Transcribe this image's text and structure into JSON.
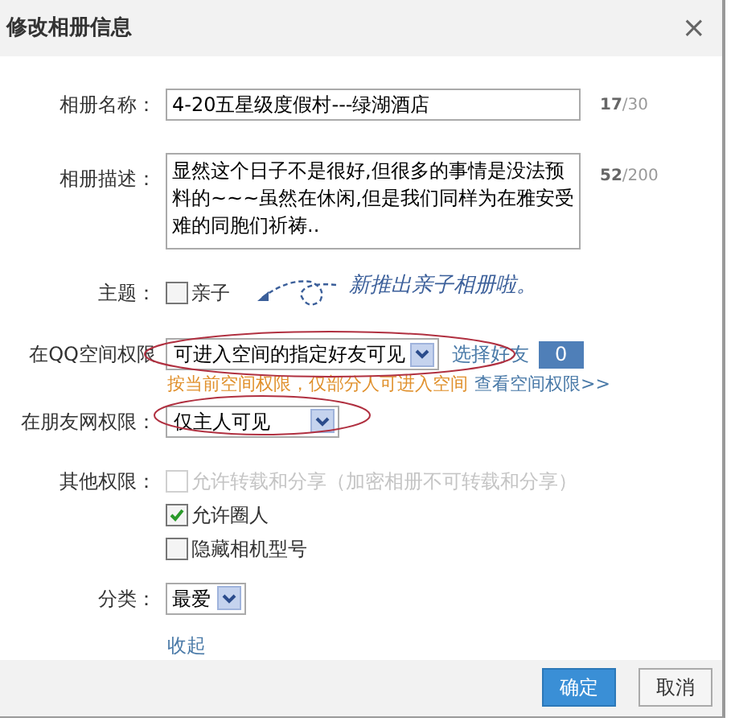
{
  "dialog": {
    "title": "修改相册信息",
    "close": "×"
  },
  "name_field": {
    "label": "相册名称：",
    "value": "4-20五星级度假村---绿湖酒店",
    "counter_used": "17",
    "counter_max": "/30"
  },
  "description_field": {
    "label": "相册描述：",
    "value": "显然这个日子不是很好,但很多的事情是没法预料的~~~虽然在休闲,但是我们同样为在雅安受难的同胞们祈祷..",
    "counter_used": "52",
    "counter_max": "/200"
  },
  "theme": {
    "label": "主题：",
    "option": {
      "label": "亲子",
      "checked": false
    },
    "annotation": "新推出亲子相册啦。"
  },
  "qq_permission": {
    "label": "在QQ空间权限",
    "value": "可进入空间的指定好友可见",
    "select_friends": "选择好友",
    "friend_count": "0",
    "hint": "按当前空间权限，仅部分人可进入空间",
    "link": "查看空间权限>>"
  },
  "friend_permission": {
    "label": "在朋友网权限：",
    "value": "仅主人可见"
  },
  "other_permissions": {
    "label": "其他权限：",
    "options": [
      {
        "label": "允许转载和分享（加密相册不可转载和分享）",
        "checked": false,
        "disabled": true
      },
      {
        "label": "允许圈人",
        "checked": true,
        "disabled": false
      },
      {
        "label": "隐藏相机型号",
        "checked": false,
        "disabled": false
      }
    ]
  },
  "category": {
    "label": "分类：",
    "value": "最爱"
  },
  "collapse_link": "收起",
  "buttons": [
    {
      "label": "确定",
      "kind": "primary"
    },
    {
      "label": "取消",
      "kind": "secondary"
    }
  ]
}
